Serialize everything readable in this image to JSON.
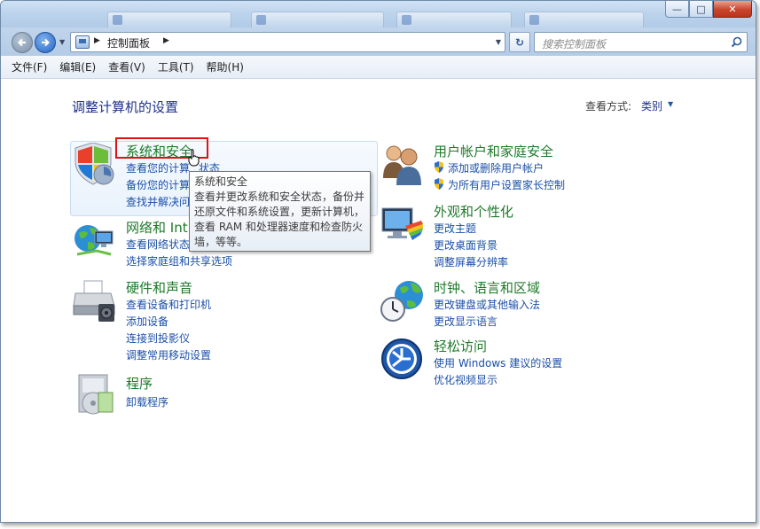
{
  "window": {
    "background_tabs": [
      "",
      "",
      "",
      ""
    ],
    "caption_buttons": {
      "minimize": "—",
      "maximize": "□",
      "close": "✕"
    }
  },
  "address": {
    "location": "控制面板",
    "refresh_glyph": "↻"
  },
  "search": {
    "placeholder": "搜索控制面板"
  },
  "menu": [
    "文件(F)",
    "编辑(E)",
    "查看(V)",
    "工具(T)",
    "帮助(H)"
  ],
  "page": {
    "title": "调整计算机的设置",
    "view_by_label": "查看方式:",
    "view_by_value": "类别"
  },
  "categories": [
    {
      "title": "系统和安全",
      "icon": "shield-icon",
      "links": [
        "查看您的计算机状态",
        "备份您的计算机",
        "查找并解决问题"
      ]
    },
    {
      "title": "网络和 Internet",
      "icon": "network-icon",
      "links": [
        "查看网络状态和任务",
        "选择家庭组和共享选项"
      ]
    },
    {
      "title": "硬件和声音",
      "icon": "printer-icon",
      "links": [
        "查看设备和打印机",
        "添加设备",
        "连接到投影仪",
        "调整常用移动设置"
      ]
    },
    {
      "title": "程序",
      "icon": "programs-icon",
      "links": [
        "卸载程序"
      ]
    },
    {
      "title": "用户帐户和家庭安全",
      "icon": "users-icon",
      "links": [
        "添加或删除用户帐户",
        "为所有用户设置家长控制"
      ]
    },
    {
      "title": "外观和个性化",
      "icon": "monitor-icon",
      "links": [
        "更改主题",
        "更改桌面背景",
        "调整屏幕分辨率"
      ]
    },
    {
      "title": "时钟、语言和区域",
      "icon": "clock-globe-icon",
      "links": [
        "更改键盘或其他输入法",
        "更改显示语言"
      ]
    },
    {
      "title": "轻松访问",
      "icon": "ease-of-access-icon",
      "links": [
        "使用 Windows 建议的设置",
        "优化视频显示"
      ]
    }
  ],
  "visible_text": {
    "system_links": [
      "查看您的计算",
      "状态",
      "备份您的计算",
      "查找并解决问"
    ],
    "network_title": "网络和 Int",
    "network_link1": "查看网络状态"
  },
  "tooltip": {
    "title": "系统和安全",
    "lines": [
      "查看并更改系统和安全状态，备份并",
      "还原文件和系统设置，更新计算机，",
      "查看 RAM 和处理器速度和检查防火",
      "墙，等等。"
    ]
  },
  "colors": {
    "category_title": "#1e7a2a",
    "link": "#1a4fa8",
    "page_title": "#1e3287",
    "annotation_box": "#e0101a"
  }
}
